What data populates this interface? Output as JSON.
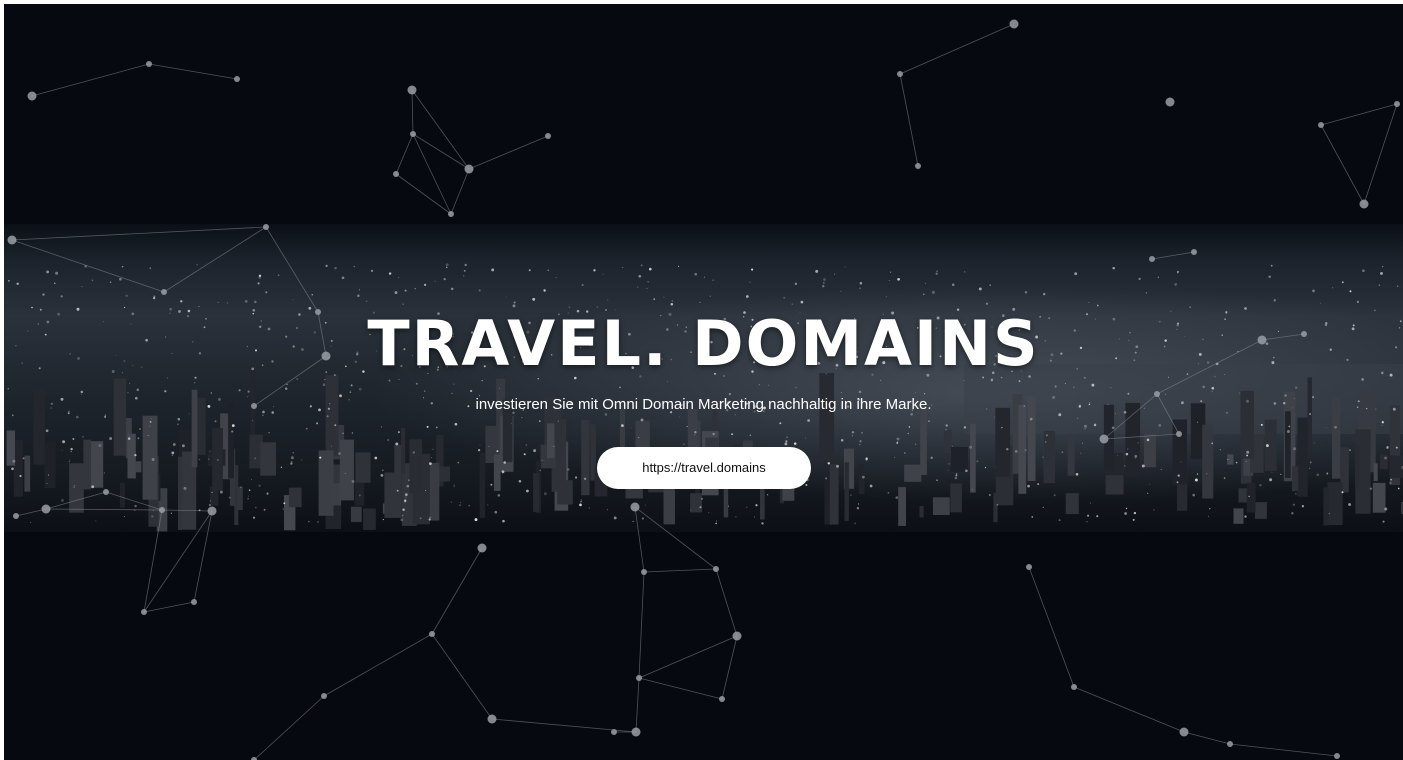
{
  "hero": {
    "title": "TRAVEL. DOMAINS",
    "subtitle": "investieren Sie mit Omni Domain Marketing nachhaltig in ihre Marke.",
    "cta_label": "https://travel.domains"
  },
  "colors": {
    "background": "#060a10",
    "title": "#ffffff",
    "button_bg": "#ffffff",
    "button_text": "#111111"
  }
}
